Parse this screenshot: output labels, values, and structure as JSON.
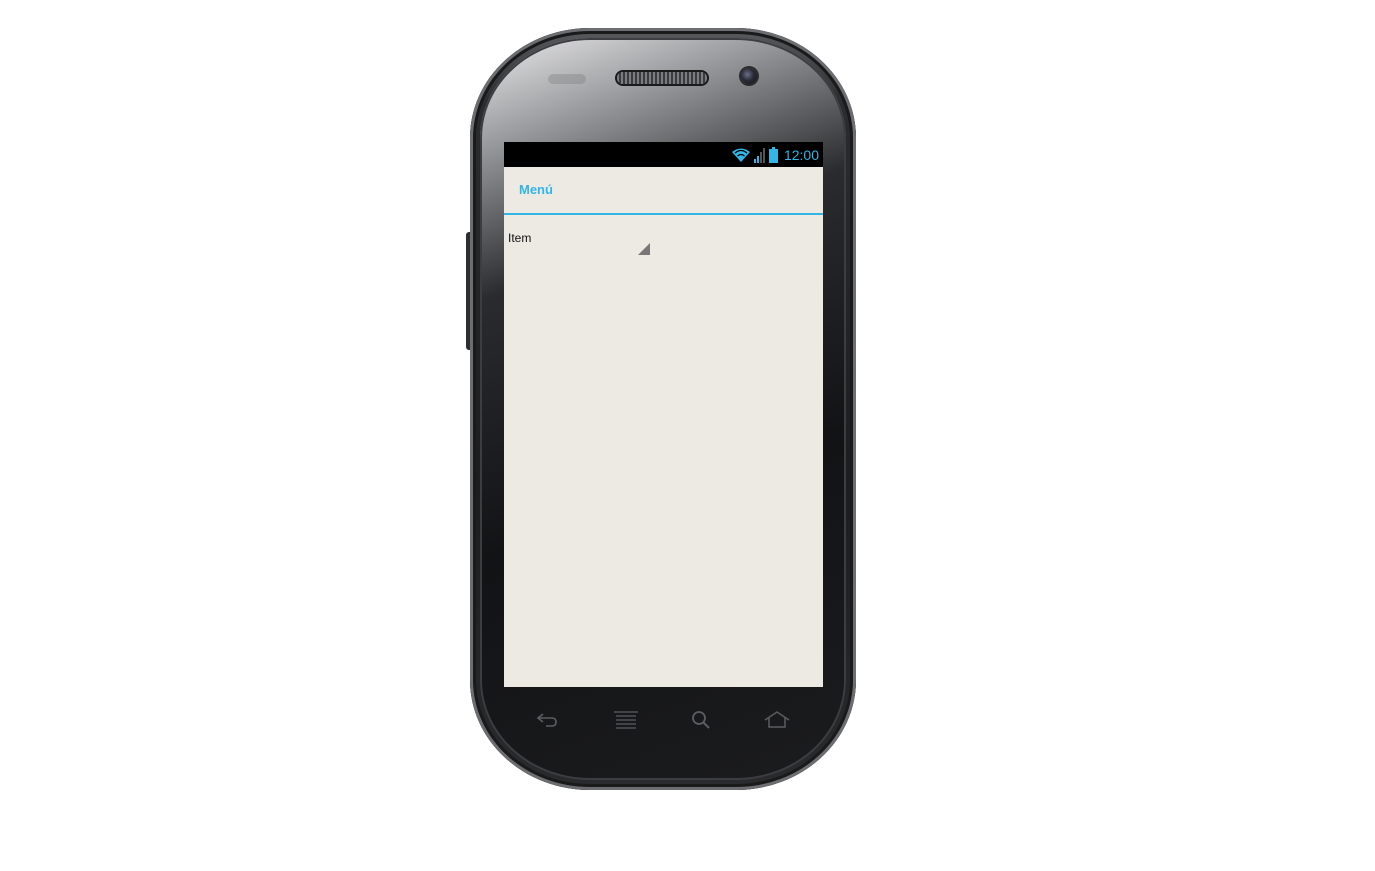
{
  "status_bar": {
    "time": "12:00",
    "icons": [
      "wifi-icon",
      "signal-icon",
      "battery-icon"
    ]
  },
  "action_bar": {
    "title": "Menú"
  },
  "spinner": {
    "selected": "Item"
  },
  "nav_bar": {
    "buttons": [
      "back-icon",
      "menu-icon",
      "search-icon",
      "home-icon"
    ]
  },
  "colors": {
    "accent": "#33b5e5",
    "screen_background": "#edeae4",
    "status_bar_background": "#000000"
  }
}
